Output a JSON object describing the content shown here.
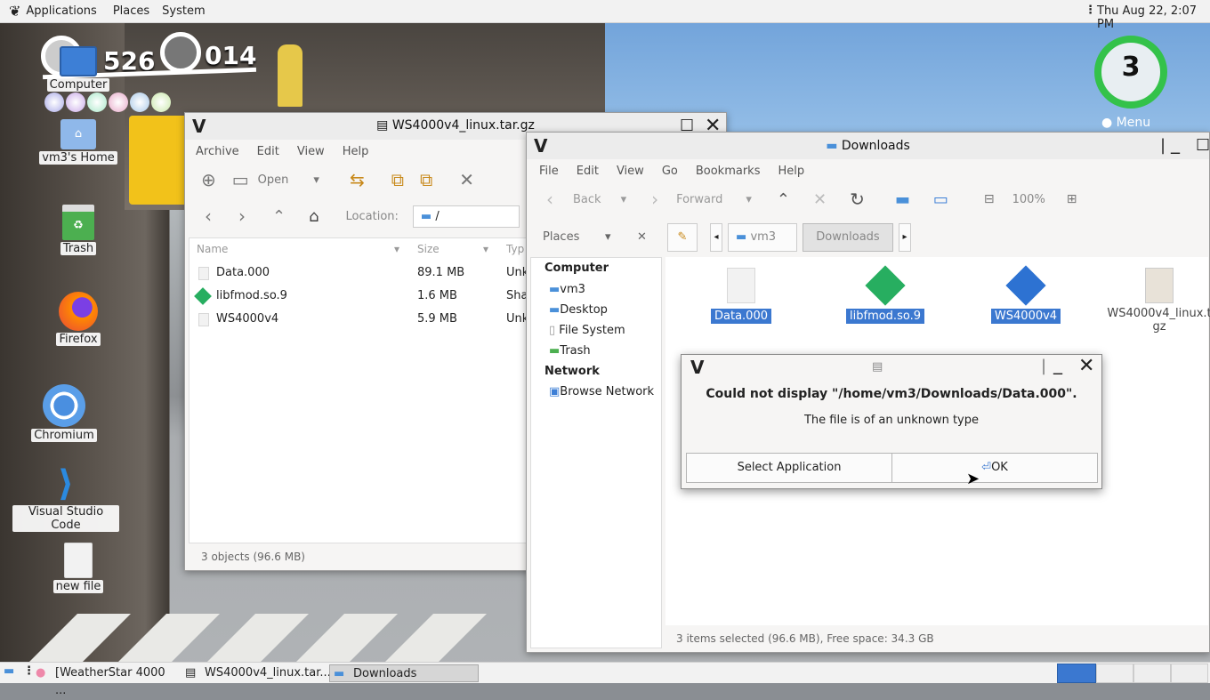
{
  "topbar": {
    "applications": "Applications",
    "places": "Places",
    "system": "System",
    "clock": "Thu Aug 22,  2:07 PM"
  },
  "hud": {
    "coins": "526",
    "moons": "014",
    "life": "3",
    "menu": "Menu"
  },
  "desktop_icons": [
    {
      "label": "Computer"
    },
    {
      "label": "vm3's Home"
    },
    {
      "label": "Trash"
    },
    {
      "label": "Firefox"
    },
    {
      "label": "Chromium"
    },
    {
      "label": "Visual Studio Code"
    },
    {
      "label": "new file"
    }
  ],
  "archive_window": {
    "title": "WS4000v4_linux.tar.gz",
    "menu": [
      "Archive",
      "Edit",
      "View",
      "Help"
    ],
    "open_label": "Open",
    "location_label": "Location:",
    "location_value": "/",
    "columns": [
      "Name",
      "Size",
      "Typ"
    ],
    "rows": [
      {
        "name": "Data.000",
        "size": "89.1 MB",
        "type": "Unk"
      },
      {
        "name": "libfmod.so.9",
        "size": "1.6 MB",
        "type": "Sha"
      },
      {
        "name": "WS4000v4",
        "size": "5.9 MB",
        "type": "Unk"
      }
    ],
    "status": "3 objects (96.6 MB)"
  },
  "files_window": {
    "title": "Downloads",
    "menu": [
      "File",
      "Edit",
      "View",
      "Go",
      "Bookmarks",
      "Help"
    ],
    "back": "Back",
    "forward": "Forward",
    "zoom": "100%",
    "places_label": "Places",
    "breadcrumb": [
      "vm3",
      "Downloads"
    ],
    "sidebar_computer": "Computer",
    "sidebar_items": [
      "vm3",
      "Desktop",
      "File System",
      "Trash"
    ],
    "sidebar_network": "Network",
    "sidebar_network_items": [
      "Browse Network"
    ],
    "files": [
      {
        "name": "Data.000"
      },
      {
        "name": "libfmod.so.9"
      },
      {
        "name": "WS4000v4"
      },
      {
        "name_line1": "WS4000v4_linux.t",
        "name_line2": "gz"
      }
    ],
    "status": "3 items selected (96.6 MB), Free space: 34.3 GB"
  },
  "dialog": {
    "heading": "Could not display \"/home/vm3/Downloads/Data.000\".",
    "message": "The file is of an unknown type",
    "select_button": "Select Application",
    "ok_button": "OK"
  },
  "taskbar": {
    "tasks": [
      "[WeatherStar 4000 ...",
      "WS4000v4_linux.tar....",
      "Downloads"
    ]
  },
  "colors": {
    "selection": "#3b78d0",
    "green_ring": "#34c24a",
    "accent_blue": "#4a90d9"
  }
}
